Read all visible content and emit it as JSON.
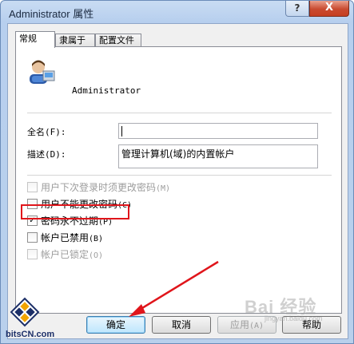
{
  "window": {
    "title": "Administrator 属性",
    "help_label": "?",
    "close_label": "X"
  },
  "tabs": [
    {
      "label": "常规"
    },
    {
      "label": "隶属于"
    },
    {
      "label": "配置文件"
    }
  ],
  "user": {
    "name": "Administrator"
  },
  "fields": {
    "fullname": {
      "label": "全名(F):",
      "value": ""
    },
    "description": {
      "label": "描述(D):",
      "value": "管理计算机(域)的内置帐户"
    }
  },
  "checkboxes": [
    {
      "label": "用户下次登录时须更改密码",
      "shortcut": "(M)",
      "checked": false,
      "disabled": true
    },
    {
      "label": "用户不能更改密码",
      "shortcut": "(C)",
      "checked": false,
      "disabled": false
    },
    {
      "label": "密码永不过期",
      "shortcut": "(P)",
      "checked": true,
      "disabled": false
    },
    {
      "label": "帐户已禁用",
      "shortcut": "(B)",
      "checked": false,
      "disabled": false
    },
    {
      "label": "帐户已锁定",
      "shortcut": "(O)",
      "checked": false,
      "disabled": true
    }
  ],
  "buttons": {
    "ok": "确定",
    "cancel": "取消",
    "apply": "应用",
    "apply_shortcut": "(A)",
    "help": "帮助"
  },
  "watermark": {
    "text": "Bai 经验",
    "sub": "jingyan.baidu.com"
  },
  "logo": {
    "text": "bitsCN.com"
  },
  "colors": {
    "highlight": "#e0151b",
    "arrow": "#e0151b"
  }
}
